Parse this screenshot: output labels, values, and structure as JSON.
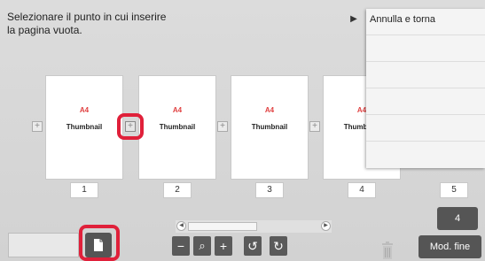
{
  "instruction": "Selezionare il punto in cui inserire\nla pagina vuota.",
  "menu": {
    "first_item": "Annulla e torna",
    "toggle_symbol": "▶"
  },
  "pages": [
    {
      "size": "A4",
      "label": "Thumbnail",
      "number": "1"
    },
    {
      "size": "A4",
      "label": "Thumbnail",
      "number": "2"
    },
    {
      "size": "A4",
      "label": "Thumbnail",
      "number": "3"
    },
    {
      "size": "A4",
      "label": "Thumbnail",
      "number": "4"
    },
    {
      "number": "5"
    }
  ],
  "insert_symbol": "+",
  "page_count_button": "4",
  "mod_fine_button": "Mod. fine",
  "toolbar": {
    "zoom_out": "−",
    "zoom_reset": "⌕",
    "zoom_in": "+",
    "rotate_left": "↺",
    "rotate_right": "↻"
  },
  "scroll": {
    "left": "◀",
    "right": "▶"
  },
  "colors": {
    "highlight": "#e0203a",
    "size_text": "#e04040",
    "dark_button": "#555555"
  }
}
